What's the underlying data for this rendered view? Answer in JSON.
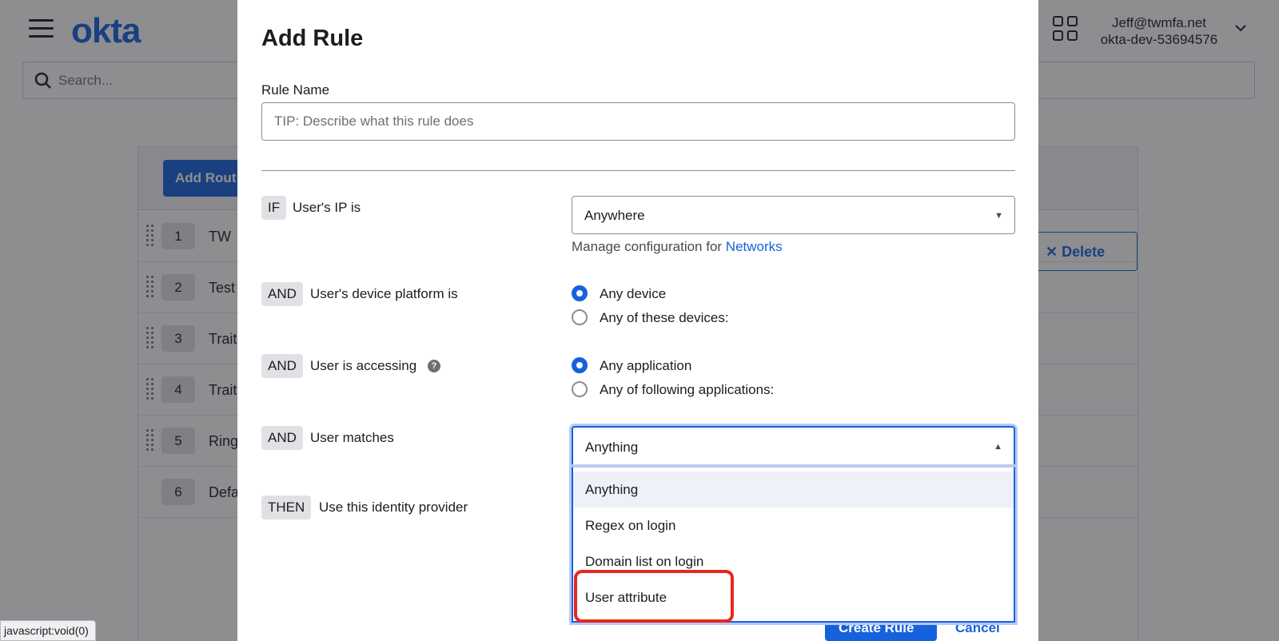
{
  "app": {
    "logo": "okta",
    "search_placeholder": "Search...",
    "user_email": "Jeff@twmfa.net",
    "org": "okta-dev-53694576",
    "add_route_label": "Add Rout",
    "delete_label": "Delete",
    "routes": [
      {
        "num": "1",
        "name": "TW"
      },
      {
        "num": "2",
        "name": "Test"
      },
      {
        "num": "3",
        "name": "Trait"
      },
      {
        "num": "4",
        "name": "Trait"
      },
      {
        "num": "5",
        "name": "Ring"
      },
      {
        "num": "6",
        "name": "Defa"
      }
    ],
    "status_bar": "javascript:void(0)"
  },
  "modal": {
    "title": "Add Rule",
    "rule_name_label": "Rule Name",
    "rule_name_placeholder": "TIP: Describe what this rule does",
    "conditions": {
      "ip": {
        "keyword": "IF",
        "text": "User's IP is",
        "value": "Anywhere",
        "manage_text": "Manage configuration for",
        "manage_link": "Networks"
      },
      "device": {
        "keyword": "AND",
        "text": "User's device platform is",
        "options": [
          "Any device",
          "Any of these devices:"
        ],
        "selected": "Any device"
      },
      "app": {
        "keyword": "AND",
        "text": "User is accessing",
        "help": "?",
        "options": [
          "Any application",
          "Any of following applications:"
        ],
        "selected": "Any application"
      },
      "match": {
        "keyword": "AND",
        "text": "User matches",
        "value": "Anything",
        "options": [
          "Anything",
          "Regex on login",
          "Domain list on login",
          "User attribute"
        ],
        "highlighted_option": "Anything"
      },
      "then": {
        "keyword": "THEN",
        "text": "Use this identity provider"
      }
    },
    "create_label": "Create Rule",
    "cancel_label": "Cancel"
  },
  "colors": {
    "accent": "#1662dd",
    "annotation": "#e8281e",
    "overlay": "rgba(30,30,35,0.5)"
  }
}
